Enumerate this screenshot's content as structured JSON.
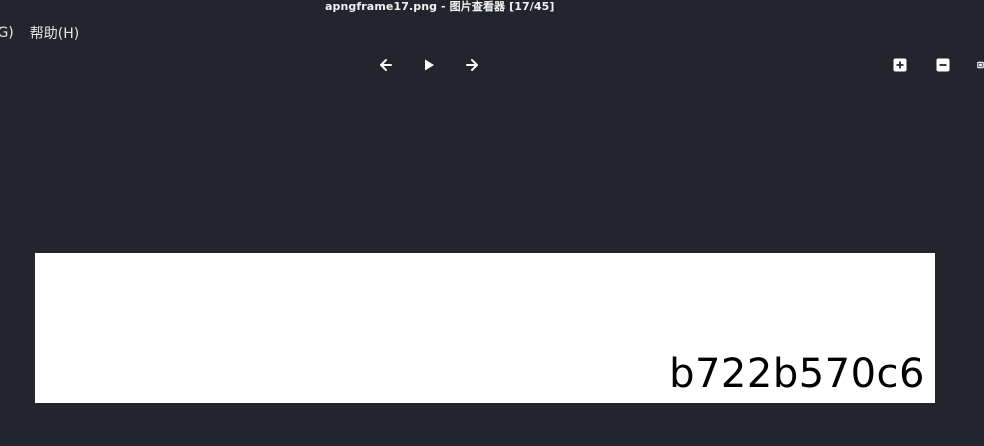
{
  "window": {
    "title": "apngframe17.png - 图片查看器 [17/45]"
  },
  "menubar": {
    "items": [
      {
        "label": "(G)"
      },
      {
        "label": "帮助(H)"
      }
    ]
  },
  "toolbar": {
    "prev_icon": "arrow-left-icon",
    "play_icon": "play-icon",
    "next_icon": "arrow-right-icon",
    "zoom_in_icon": "zoom-in-icon",
    "zoom_out_icon": "zoom-out-icon",
    "fit_icon": "fit-icon"
  },
  "image": {
    "text": "b722b570c6",
    "background": "#ffffff"
  },
  "colors": {
    "window_bg": "#23252e",
    "icon": "#ffffff"
  }
}
